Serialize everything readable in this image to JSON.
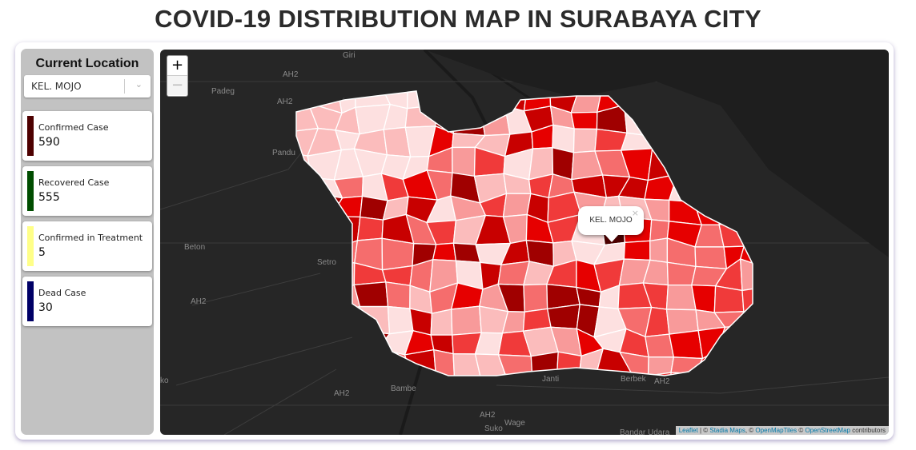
{
  "title": "COVID-19 DISTRIBUTION MAP IN SURABAYA CITY",
  "sidebar": {
    "heading": "Current Location",
    "location_select": {
      "value": "KEL. MOJO"
    },
    "cards": [
      {
        "label": "Confirmed Case",
        "value": "590",
        "color": "#4d0000"
      },
      {
        "label": "Recovered Case",
        "value": "555",
        "color": "#004d00"
      },
      {
        "label": "Confirmed in Treatment",
        "value": "5",
        "color": "#ffff88"
      },
      {
        "label": "Dead Case",
        "value": "30",
        "color": "#000066"
      }
    ]
  },
  "map": {
    "zoom_in": "+",
    "zoom_out": "−",
    "place_labels": [
      "Giri",
      "AH2",
      "Padeg",
      "AH2",
      "Pandu",
      "Beton",
      "Setro",
      "AH2",
      "ko",
      "AH2",
      "Bambe",
      "Janti",
      "Berbek",
      "AH2",
      "AH2",
      "Wage",
      "Suko",
      "Bandar Udara"
    ],
    "popup": {
      "title": "KEL. MOJO",
      "close": "×"
    },
    "attribution": {
      "leaflet": "Leaflet",
      "sep": " | © ",
      "stadia": "Stadia Maps",
      "c1": ", © ",
      "omt": "OpenMapTiles",
      "c2": " © ",
      "osm": "OpenStreetMap",
      "tail": " contributors"
    },
    "choropleth_colors": [
      "#fde0e0",
      "#fbbcbc",
      "#f89a9a",
      "#f56d6d",
      "#f03a3a",
      "#e60000",
      "#c80000",
      "#a00000"
    ],
    "selected_color": "#4d0000"
  }
}
